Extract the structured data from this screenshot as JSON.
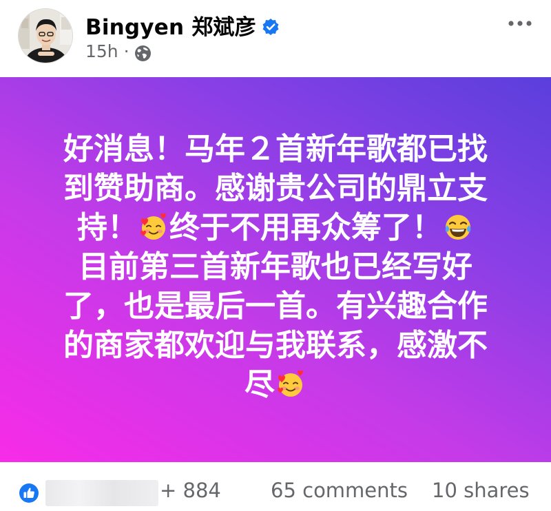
{
  "post": {
    "author": "Bingyen 郑斌彦",
    "time": "15h",
    "separator": "·",
    "body_lines": [
      "好消息！马年２首新年歌都已找",
      "到赞助商。感谢贵公司的鼎立支",
      "持！",
      "终于不用再众筹了！",
      "目前第三首新年歌也已经写好",
      "了，也是最后一首。有兴趣合作",
      "的商家都欢迎与我联系，感激不",
      "尽"
    ],
    "background_gradient": [
      "#f82be8",
      "#c43be8",
      "#8a3fe6",
      "#5a3fdc"
    ]
  },
  "icons": {
    "verified": "verified-badge-icon",
    "audience": "globe-icon",
    "more": "more-options-icon",
    "like": "like-reaction-icon",
    "emoji_love": "smiling-face-with-hearts-icon",
    "emoji_laugh": "face-with-tears-of-joy-icon"
  },
  "stats": {
    "reactions": "+ 884",
    "comments": "65 comments",
    "shares": "10 shares"
  },
  "colors": {
    "verified_blue": "#1877f2",
    "meta_gray": "#65676b"
  }
}
